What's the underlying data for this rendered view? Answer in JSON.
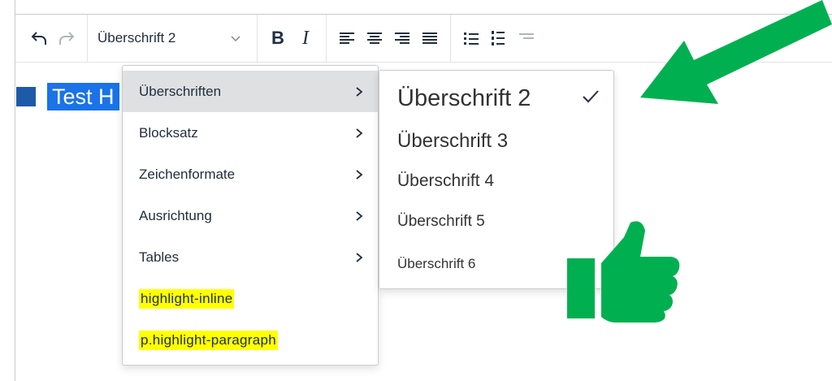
{
  "toolbar": {
    "block_format_value": "Überschrift 2",
    "icons": [
      "undo-icon",
      "redo-icon",
      "chevron-down-icon",
      "bold-icon",
      "italic-icon",
      "align-left-icon",
      "align-center-icon",
      "align-right-icon",
      "justify-icon",
      "bullet-list-icon",
      "numbered-list-icon",
      "indent-icon"
    ],
    "bold_label": "B",
    "italic_label": "I"
  },
  "content": {
    "selected_text": "Test H"
  },
  "format_menu": {
    "items": [
      {
        "label": "Überschriften",
        "has_submenu": true,
        "active": true
      },
      {
        "label": "Blocksatz",
        "has_submenu": true
      },
      {
        "label": "Zeichenformate",
        "has_submenu": true
      },
      {
        "label": "Ausrichtung",
        "has_submenu": true
      },
      {
        "label": "Tables",
        "has_submenu": true
      },
      {
        "label": "highlight-inline",
        "highlighted": true
      },
      {
        "label": "p.highlight-paragraph",
        "highlighted": true
      }
    ]
  },
  "heading_submenu": {
    "items": [
      {
        "label": "Überschrift 2",
        "checked": true
      },
      {
        "label": "Überschrift 3"
      },
      {
        "label": "Überschrift 4"
      },
      {
        "label": "Überschrift 5"
      },
      {
        "label": "Überschrift 6"
      }
    ]
  },
  "colors": {
    "annotation_green": "#00b050",
    "selection_blue": "#1a73e8",
    "highlight_yellow": "#ffff00",
    "menu_active": "#dee0e2"
  }
}
